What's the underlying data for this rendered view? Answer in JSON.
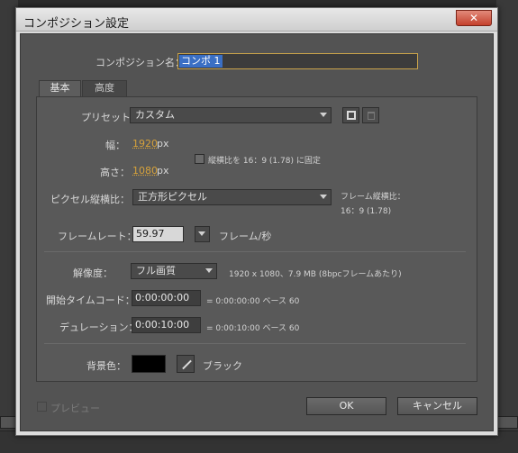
{
  "window": {
    "title": "コンポジション設定",
    "close_label": "✕"
  },
  "comp_name": {
    "label": "コンポジション名：",
    "value": "コンポ 1"
  },
  "tabs": [
    {
      "label": "基本"
    },
    {
      "label": "高度"
    }
  ],
  "preset": {
    "label": "プリセット：",
    "value": "カスタム"
  },
  "width": {
    "label": "幅：",
    "value": "1920",
    "unit": "px"
  },
  "height": {
    "label": "高さ：",
    "value": "1080",
    "unit": "px"
  },
  "lock_aspect": {
    "label": "縦横比を 16：9 (1.78) に固定",
    "checked": false
  },
  "pixel_aspect": {
    "label": "ピクセル縦横比：",
    "value": "正方形ピクセル"
  },
  "frame_aspect": {
    "label": "フレーム縦横比：",
    "value": "16：9 (1.78)"
  },
  "frame_rate": {
    "label": "フレームレート：",
    "value": "59.97",
    "unit": "フレーム/秒"
  },
  "resolution": {
    "label": "解像度：",
    "value": "フル画質",
    "info": "1920 x 1080、7.9 MB (8bpcフレームあたり)"
  },
  "start_timecode": {
    "label": "開始タイムコード：",
    "value": "0:00:00:00",
    "info": "= 0:00:00:00 ベース 60"
  },
  "duration": {
    "label": "デュレーション：",
    "value": "0:00:10:00",
    "info": "= 0:00:10:00 ベース 60"
  },
  "background": {
    "label": "背景色：",
    "color": "#000000",
    "name": "ブラック"
  },
  "preview": {
    "label": "プレビュー",
    "checked": false
  },
  "buttons": {
    "ok": "OK",
    "cancel": "キャンセル"
  }
}
